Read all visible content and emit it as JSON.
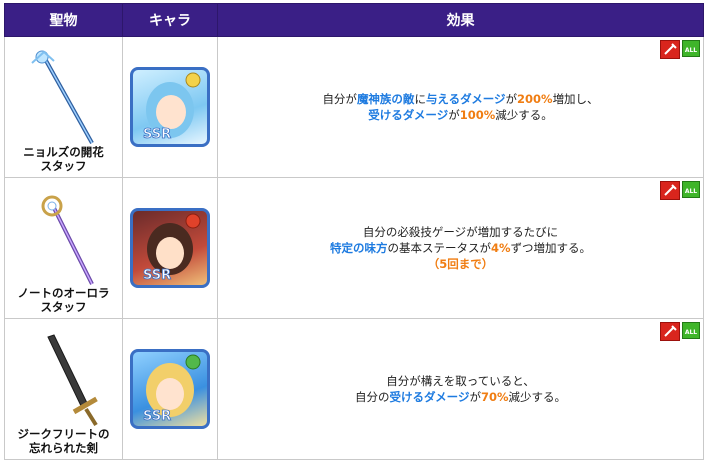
{
  "header": {
    "col_item": "聖物",
    "col_chara": "キャラ",
    "col_effect": "効果"
  },
  "rows": [
    {
      "item_name_1": "ニョルズの開花",
      "item_name_2": "スタッフ",
      "effect": {
        "l1_a": "自分が",
        "l1_b": "魔神族の敵",
        "l1_c": "に",
        "l1_d": "与えるダメージ",
        "l1_e": "が",
        "l1_f": "200%",
        "l1_g": "増加し、",
        "l2_a": "受けるダメージ",
        "l2_b": "が",
        "l2_c": "100%",
        "l2_d": "減少する。"
      }
    },
    {
      "item_name_1": "ノートのオーロラ",
      "item_name_2": "スタッフ",
      "effect": {
        "l1": "自分の必殺技ゲージが増加するたびに",
        "l2_a": "特定の味方",
        "l2_b": "の基本ステータスが",
        "l2_c": "4%",
        "l2_d": "ずつ増加する。",
        "l3": "（5回まで）"
      }
    },
    {
      "item_name_1": "ジークフリートの",
      "item_name_2": "忘れられた剣",
      "effect": {
        "l1": "自分が構えを取っていると、",
        "l2_a": "自分の",
        "l2_b": "受けるダメージ",
        "l2_c": "が",
        "l2_d": "70%",
        "l2_e": "減少する。"
      }
    }
  ],
  "badge": {
    "all_label": "ALL"
  },
  "colors": {
    "header_bg": "#3a1f86",
    "blue_text": "#1e7be0",
    "orange_text": "#f07d12"
  },
  "icons": [
    "staff-icon",
    "sword-icon",
    "sword-badge-icon",
    "all-target-icon",
    "element-icon",
    "ssr-emblem"
  ]
}
